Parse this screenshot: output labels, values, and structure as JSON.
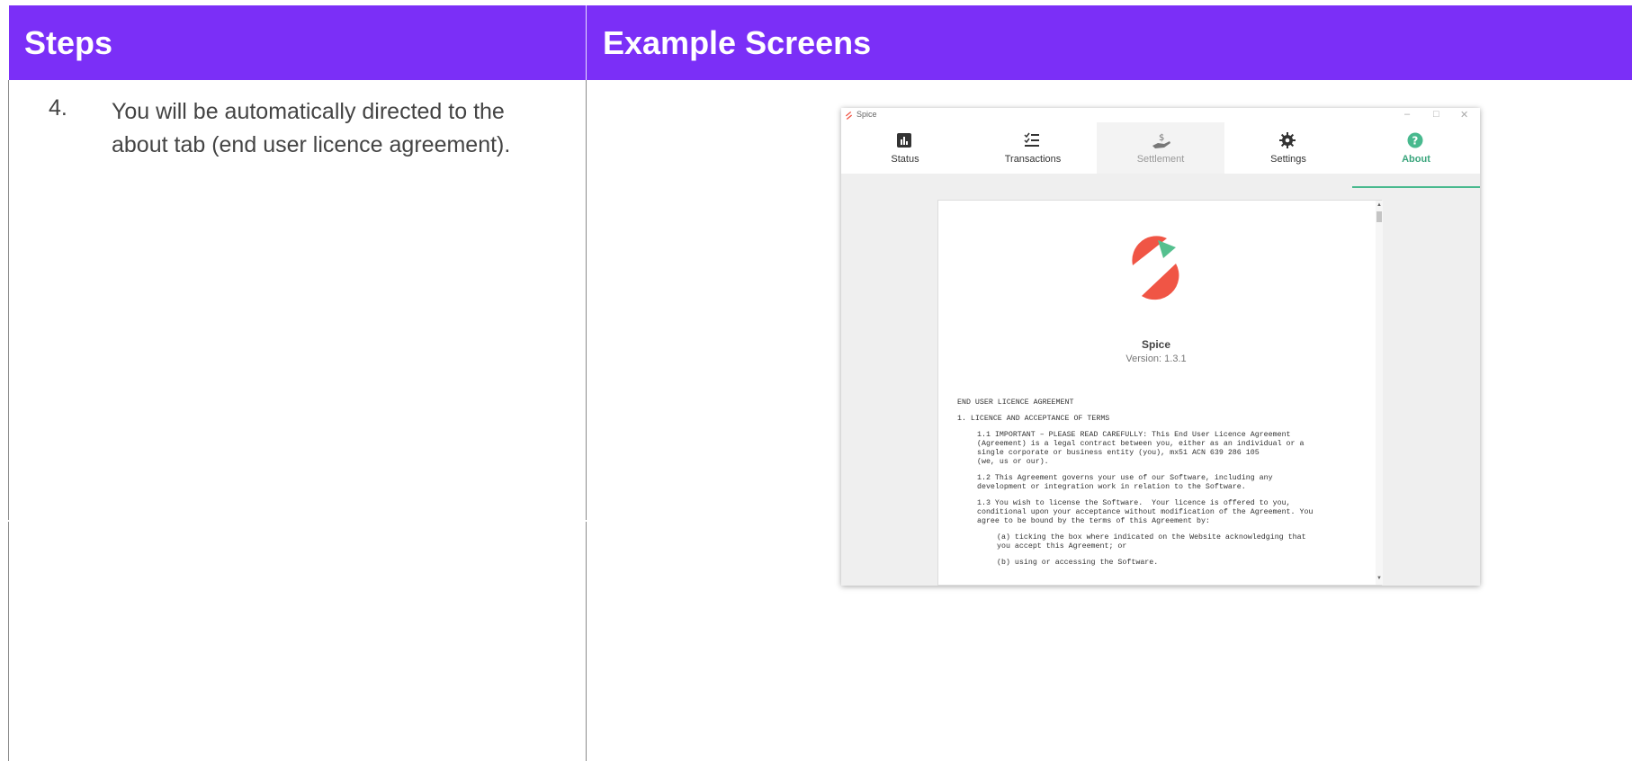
{
  "table": {
    "headers": {
      "steps": "Steps",
      "screens": "Example Screens"
    },
    "step": {
      "number": "4.",
      "text": "You will be automatically directed to the about tab (end user licence agreement)."
    }
  },
  "app": {
    "window_title": "Spice",
    "window_controls": {
      "minimize": "–",
      "maximize": "□",
      "close": "✕"
    },
    "tabs": [
      {
        "label": "Status",
        "icon": "bar-chart-icon"
      },
      {
        "label": "Transactions",
        "icon": "checklist-icon"
      },
      {
        "label": "Settlement",
        "icon": "hand-dollar-icon"
      },
      {
        "label": "Settings",
        "icon": "gear-icon"
      },
      {
        "label": "About",
        "icon": "question-circle-icon"
      }
    ],
    "active_tab": "About",
    "about": {
      "product_name": "Spice",
      "version": "Version: 1.3.1",
      "eula": {
        "title": "END USER LICENCE AGREEMENT",
        "section1": "1. LICENCE AND ACCEPTANCE OF TERMS",
        "p11": "1.1 IMPORTANT – PLEASE READ CAREFULLY: This End User Licence Agreement\n(Agreement) is a legal contract between you, either as an individual or a\nsingle corporate or business entity (you), mx51 ACN 639 286 105\n(we, us or our).",
        "p12": "1.2 This Agreement governs your use of our Software, including any\ndevelopment or integration work in relation to the Software.",
        "p13": "1.3 You wish to license the Software.  Your licence is offered to you,\nconditional upon your acceptance without modification of the Agreement. You\nagree to be bound by the terms of this Agreement by:",
        "pa": "(a) ticking the box where indicated on the Website acknowledging that\nyou accept this Agreement; or",
        "pb": "(b) using or accessing the Software."
      }
    },
    "colors": {
      "header_bg": "#7b2ff7",
      "accent": "#48b98e",
      "logo_red": "#f05545",
      "logo_green": "#55c08f"
    }
  }
}
